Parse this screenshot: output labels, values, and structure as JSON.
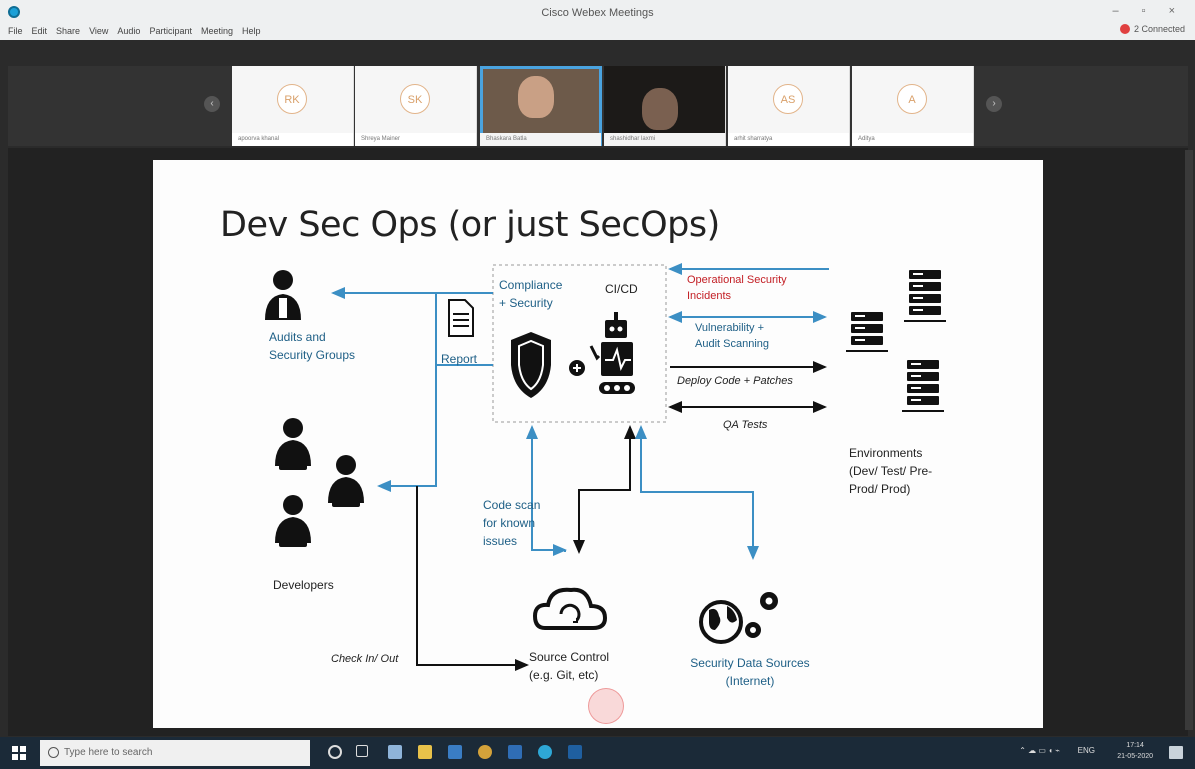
{
  "window": {
    "title": "Cisco Webex Meetings",
    "controls": "– ▫ ×",
    "menu": [
      "File",
      "Edit",
      "Share",
      "View",
      "Audio",
      "Participant",
      "Meeting",
      "Help"
    ],
    "connection_status": "2 Connected"
  },
  "participants": [
    {
      "initials": "RK",
      "name": "apoorva khanal"
    },
    {
      "initials": "SK",
      "name": "Shreya Mainer"
    },
    {
      "initials": "",
      "name": "Bhaskara Batla"
    },
    {
      "initials": "",
      "name": "shashidhar laxmi"
    },
    {
      "initials": "AS",
      "name": "arhit sharratya"
    },
    {
      "initials": "A",
      "name": "Aditya"
    }
  ],
  "slide": {
    "title": "Dev Sec Ops (or just SecOps)",
    "audits_label": [
      "Audits and",
      "Security Groups"
    ],
    "report_label": "Report",
    "compliance_label": [
      "Compliance",
      "+ Security"
    ],
    "cicd_label": "CI/CD",
    "ops_incidents": [
      "Operational Security",
      "Incidents"
    ],
    "vuln_scan": [
      "Vulnerability +",
      "Audit Scanning"
    ],
    "deploy_label": "Deploy Code + Patches",
    "qa_label": "QA Tests",
    "environments_label": [
      "Environments",
      "(Dev/ Test/ Pre-",
      "Prod/ Prod)"
    ],
    "developers_label": "Developers",
    "code_scan_label": [
      "Code scan",
      "for known",
      "issues"
    ],
    "checkin_label": "Check In/ Out",
    "source_control_label": [
      "Source Control",
      "(e.g. Git, etc)"
    ],
    "security_sources_label": [
      "Security Data Sources",
      "(Internet)"
    ]
  },
  "taskbar": {
    "search_placeholder": "Type here to search",
    "lang": "ENG",
    "time": "17:14",
    "date": "21-05-2020"
  },
  "colors": {
    "arrow_blue": "#3c8fc4",
    "label_blue": "#1e5f86",
    "label_red": "#c32026",
    "icon_black": "#111111"
  }
}
